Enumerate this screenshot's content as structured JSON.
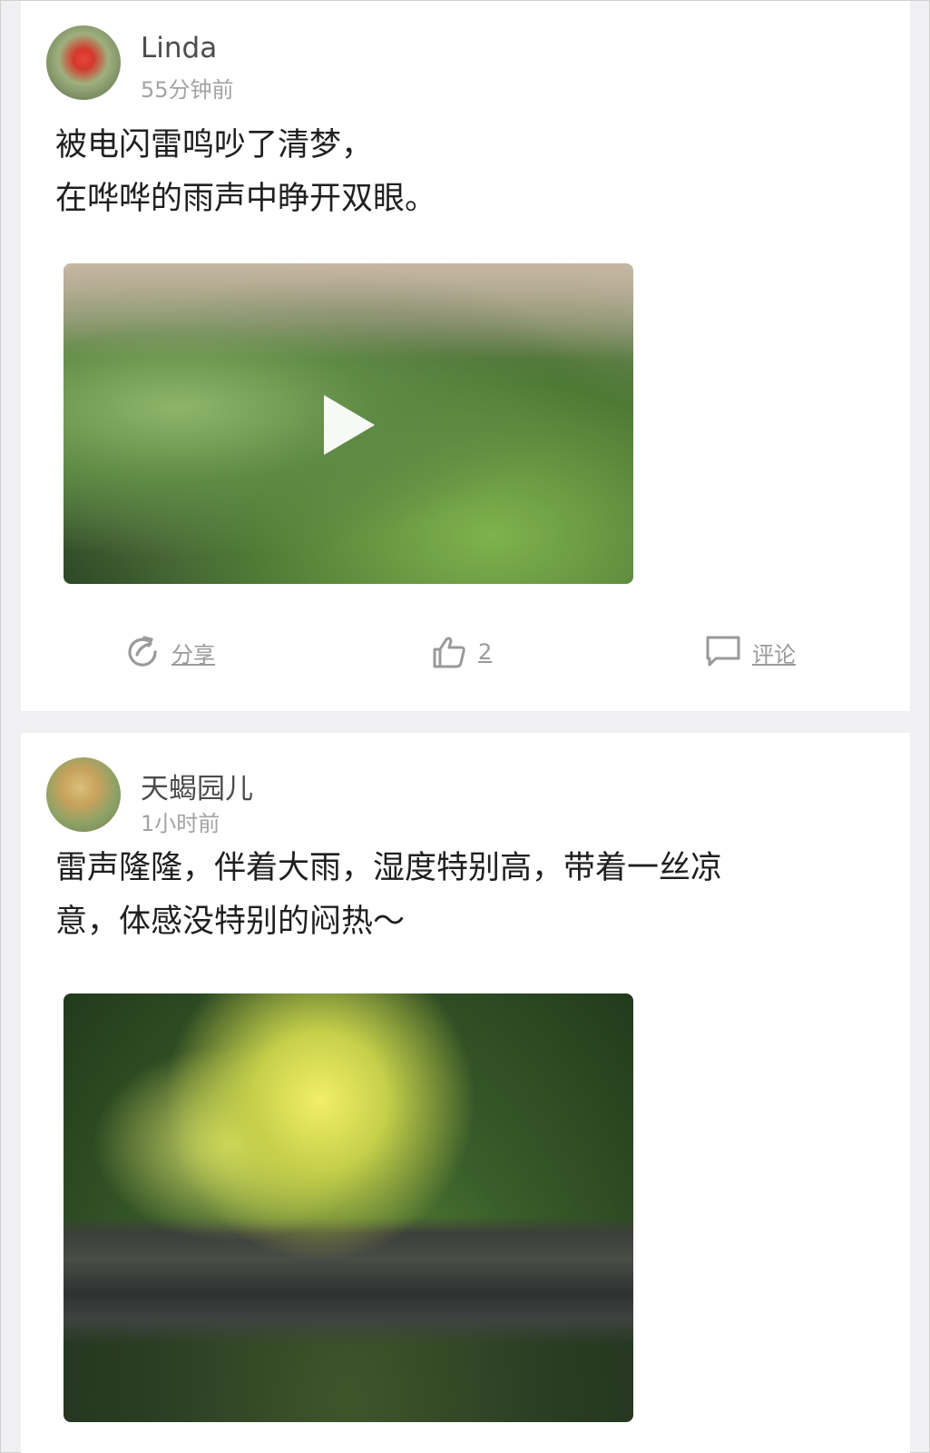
{
  "posts": [
    {
      "author": "Linda",
      "time": "55分钟前",
      "lines": [
        "被电闪雷鸣吵了清梦，",
        "在哗哗的雨声中睁开双眼。"
      ],
      "media_type": "video",
      "actions": {
        "share_label": "分享",
        "like_count": "2",
        "comment_label": "评论"
      }
    },
    {
      "author": "天蝎园儿",
      "time": "1小时前",
      "lines": [
        "雷声隆隆，伴着大雨，湿度特别高，带着一丝凉",
        "意，体感没特别的闷热～"
      ],
      "media_type": "image"
    }
  ],
  "icons": {
    "share": "share-icon",
    "like": "thumbs-up-icon",
    "comment": "comment-icon",
    "play": "play-icon"
  },
  "colors": {
    "background": "#f0f0f2",
    "card": "#ffffff",
    "text": "#1f1f1f",
    "name": "#4c4c4c",
    "meta": "#a3a3a3",
    "action": "#9a9a9a"
  }
}
